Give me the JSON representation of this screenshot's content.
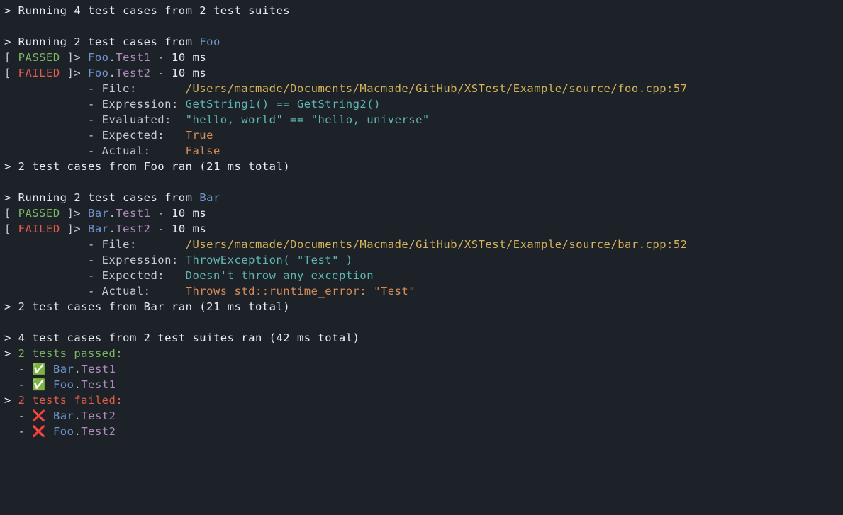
{
  "header": {
    "prefix": "> ",
    "text": "Running 4 test cases from 2 test suites"
  },
  "suites": [
    {
      "name": "Foo",
      "running_prefix": "> ",
      "running_text_a": "Running 2 test cases from ",
      "tests": [
        {
          "status_open": "[ ",
          "status": "PASSED",
          "status_close": " ]> ",
          "suite": "Foo",
          "dot": ".",
          "name": "Test1",
          "sep": " - ",
          "time": "10 ms"
        },
        {
          "status_open": "[ ",
          "status": "FAILED",
          "status_close": " ]> ",
          "suite": "Foo",
          "dot": ".",
          "name": "Test2",
          "sep": " - ",
          "time": "10 ms",
          "detail": {
            "indent": "            ",
            "file_label": "- File:       ",
            "file_value": "/Users/macmade/Documents/Macmade/GitHub/XSTest/Example/source/foo.cpp:57",
            "expr_label": "- Expression: ",
            "expr_value": "GetString1() == GetString2()",
            "eval_label": "- Evaluated:  ",
            "eval_value": "\"hello, world\" == \"hello, universe\"",
            "expected_label": "- Expected:   ",
            "expected_value": "True",
            "actual_label": "- Actual:     ",
            "actual_value": "False"
          }
        }
      ],
      "ran_prefix": "> ",
      "ran_text": "2 test cases from Foo ran (21 ms total)"
    },
    {
      "name": "Bar",
      "running_prefix": "> ",
      "running_text_a": "Running 2 test cases from ",
      "tests": [
        {
          "status_open": "[ ",
          "status": "PASSED",
          "status_close": " ]> ",
          "suite": "Bar",
          "dot": ".",
          "name": "Test1",
          "sep": " - ",
          "time": "10 ms"
        },
        {
          "status_open": "[ ",
          "status": "FAILED",
          "status_close": " ]> ",
          "suite": "Bar",
          "dot": ".",
          "name": "Test2",
          "sep": " - ",
          "time": "10 ms",
          "detail": {
            "indent": "            ",
            "file_label": "- File:       ",
            "file_value": "/Users/macmade/Documents/Macmade/GitHub/XSTest/Example/source/bar.cpp:52",
            "expr_label": "- Expression: ",
            "expr_value": "ThrowException( \"Test\" )",
            "expected_label": "- Expected:   ",
            "expected_value": "Doesn't throw any exception",
            "actual_label": "- Actual:     ",
            "actual_value": "Throws std::runtime_error: \"Test\""
          }
        }
      ],
      "ran_prefix": "> ",
      "ran_text": "2 test cases from Bar ran (21 ms total)"
    }
  ],
  "summary": {
    "total_prefix": "> ",
    "total_text": "4 test cases from 2 test suites ran (42 ms total)",
    "passed_prefix": "> ",
    "passed_text": "2 tests passed:",
    "passed_list": [
      {
        "bullet": "  - ",
        "icon": "✅ ",
        "suite": "Bar",
        "dot": ".",
        "name": "Test1"
      },
      {
        "bullet": "  - ",
        "icon": "✅ ",
        "suite": "Foo",
        "dot": ".",
        "name": "Test1"
      }
    ],
    "failed_prefix": "> ",
    "failed_text": "2 tests failed:",
    "failed_list": [
      {
        "bullet": "  - ",
        "icon": "❌ ",
        "suite": "Bar",
        "dot": ".",
        "name": "Test2"
      },
      {
        "bullet": "  - ",
        "icon": "❌ ",
        "suite": "Foo",
        "dot": ".",
        "name": "Test2"
      }
    ]
  }
}
